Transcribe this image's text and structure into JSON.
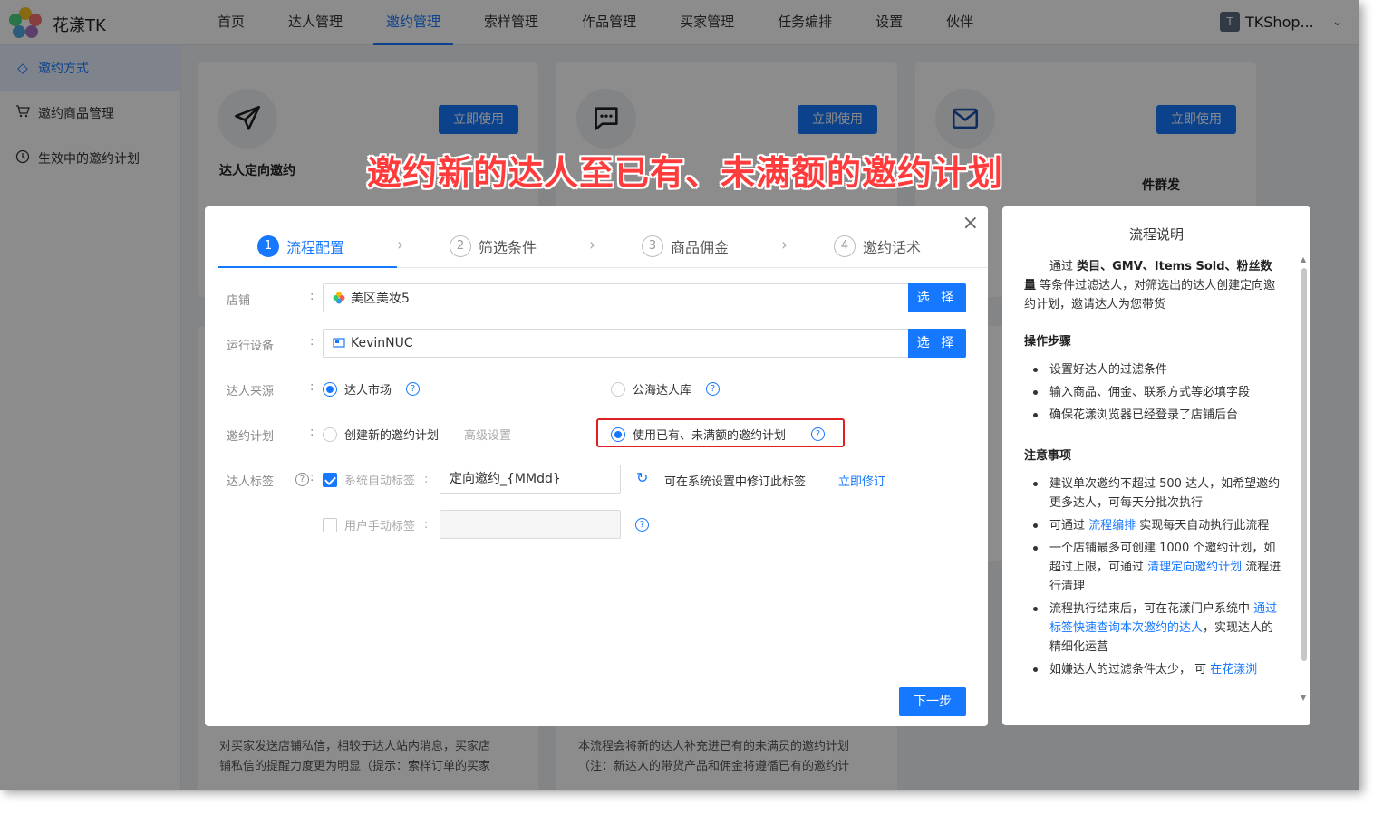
{
  "app": {
    "brand": "花漾TK"
  },
  "nav": [
    "首页",
    "达人管理",
    "邀约管理",
    "索样管理",
    "作品管理",
    "买家管理",
    "任务编排",
    "设置",
    "伙伴"
  ],
  "user": {
    "avatar": "T",
    "name": "TKShop..."
  },
  "sidebar": [
    {
      "label": "邀约方式",
      "icon": "diamond-icon"
    },
    {
      "label": "邀约商品管理",
      "icon": "cart-icon"
    },
    {
      "label": "生效中的邀约计划",
      "icon": "clock-icon"
    }
  ],
  "cards": {
    "use_label": "立即使用",
    "card1_title": "达人定向邀约",
    "card3_title": "件群发",
    "desc1_line1": "对买家发送店铺私信，相较于达人站内消息，买家店",
    "desc1_line2": "铺私信的提醒力度更为明显（提示：索样订单的买家",
    "desc2_line1": "本流程会将新的达人补充进已有的未满员的邀约计划",
    "desc2_line2": "（注：新达人的带货产品和佣金将遵循已有的邀约计"
  },
  "banner": "邀约新的达人至已有、未满额的邀约计划",
  "dialog": {
    "steps": [
      {
        "num": "1",
        "label": "流程配置"
      },
      {
        "num": "2",
        "label": "筛选条件"
      },
      {
        "num": "3",
        "label": "商品佣金"
      },
      {
        "num": "4",
        "label": "邀约话术"
      }
    ],
    "store": {
      "label": "店铺",
      "value": "美区美妆5",
      "button": "选 择"
    },
    "device": {
      "label": "运行设备",
      "value": "KevinNUC",
      "button": "选 择"
    },
    "source": {
      "label": "达人来源",
      "opt1": "达人市场",
      "opt2": "公海达人库"
    },
    "plan": {
      "label": "邀约计划",
      "opt1": "创建新的邀约计划",
      "advanced": "高级设置",
      "opt2": "使用已有、未满额的邀约计划"
    },
    "tags": {
      "label": "达人标签",
      "auto_label": "系统自动标签",
      "auto_value": "定向邀约_{MMdd}",
      "hint": "可在系统设置中修订此标签",
      "fix_link": "立即修订",
      "manual_label": "用户手动标签"
    },
    "next": "下一步"
  },
  "help": {
    "title": "流程说明",
    "intro_pre": "通过 ",
    "intro_bold": "类目、GMV、Items Sold、粉丝数量",
    "intro_post": " 等条件过滤达人，对筛选出的达人创建定向邀约计划，邀请达人为您带货",
    "steps_title": "操作步骤",
    "steps": [
      "设置好达人的过滤条件",
      "输入商品、佣金、联系方式等必填字段",
      "确保花漾浏览器已经登录了店铺后台"
    ],
    "notes_title": "注意事项",
    "note1": "建议单次邀约不超过 500 达人，如希望邀约更多达人，可每天分批次执行",
    "note2_pre": "可通过 ",
    "note2_link": "流程编排",
    "note2_post": " 实现每天自动执行此流程",
    "note3_pre": "一个店铺最多可创建 1000 个邀约计划，如超过上限，可通过 ",
    "note3_link": "清理定向邀约计划",
    "note3_post": " 流程进行清理",
    "note4_pre": "流程执行结束后，可在花漾门户系统中 ",
    "note4_link": "通过标签快速查询本次邀约的达人",
    "note4_post": "，实现达人的精细化运营",
    "note5_pre": "如嫌达人的过滤条件太少， 可 ",
    "note5_link": "在花漾浏"
  },
  "colors": {
    "accent": "#1677ff",
    "highlight": "#e02020",
    "banner": "#ff3b3b"
  }
}
